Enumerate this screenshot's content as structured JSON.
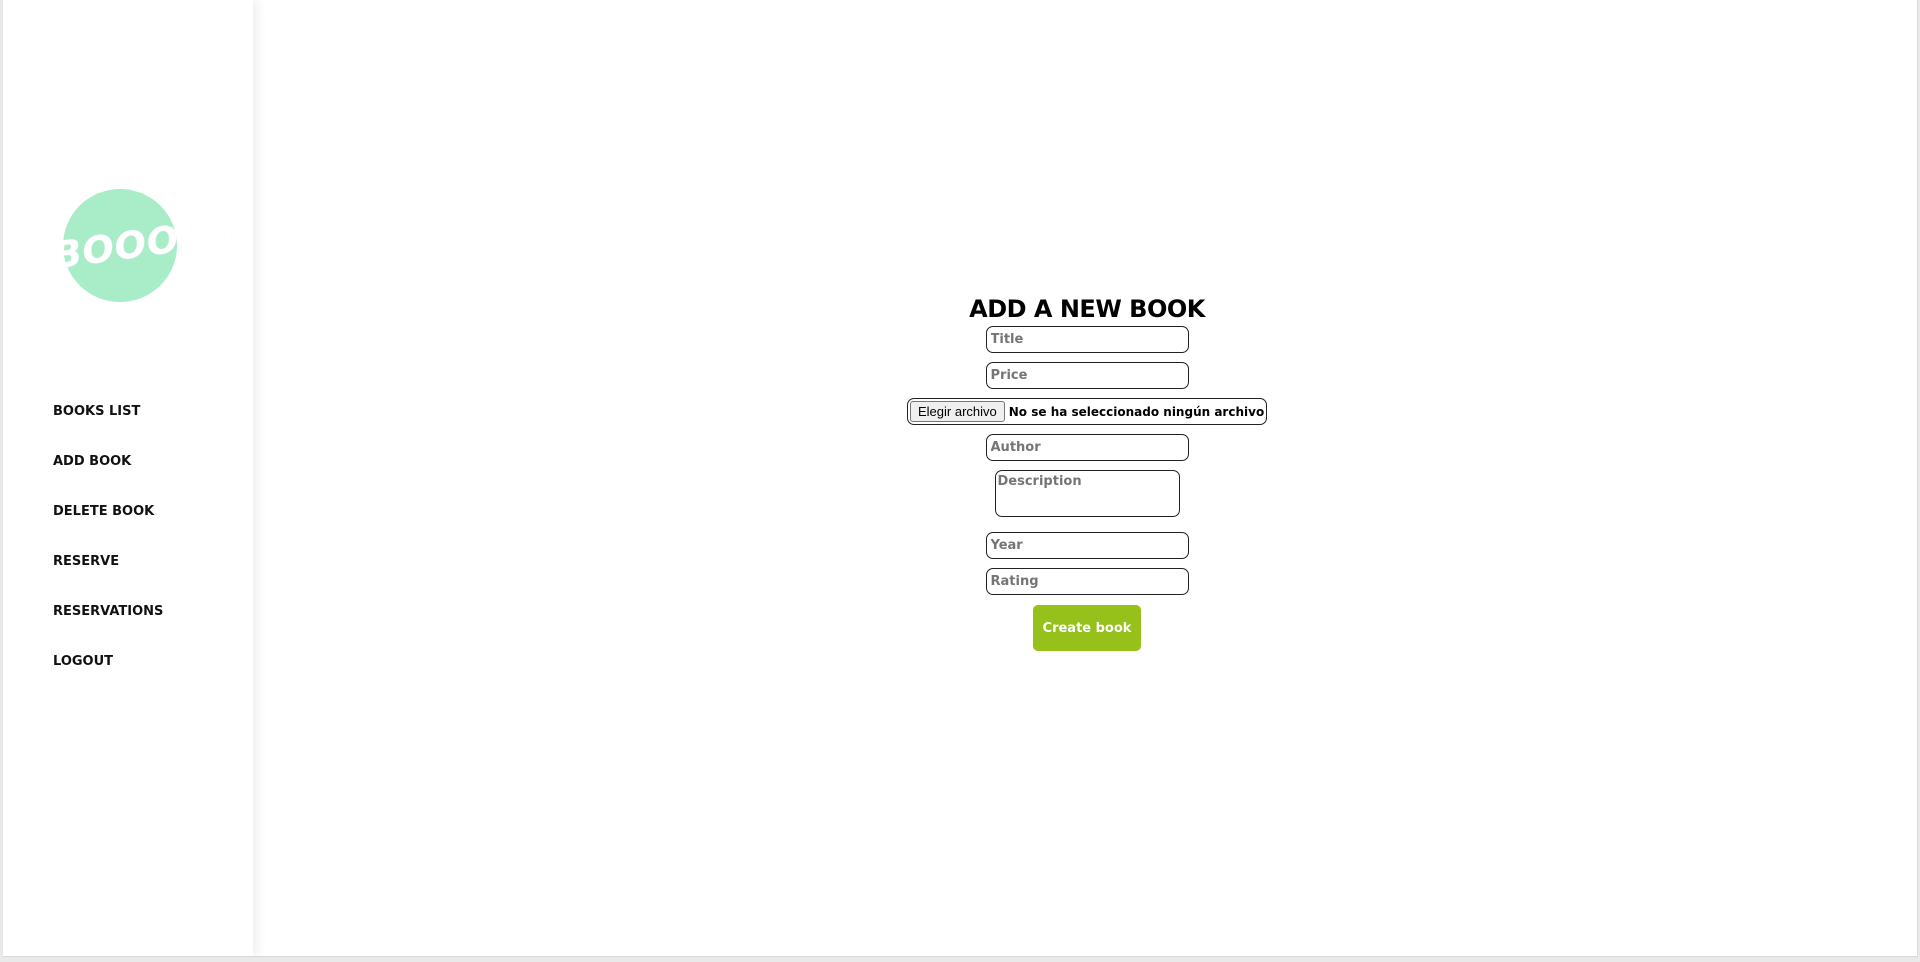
{
  "sidebar": {
    "logo_text": "BOOOKS",
    "items": [
      {
        "label": "BOOKS LIST"
      },
      {
        "label": "ADD BOOK"
      },
      {
        "label": "DELETE BOOK"
      },
      {
        "label": "RESERVE"
      },
      {
        "label": "RESERVATIONS"
      },
      {
        "label": "LOGOUT"
      }
    ]
  },
  "form": {
    "title": "ADD A NEW BOOK",
    "title_placeholder": "Title",
    "price_placeholder": "Price",
    "file_button_label": "Elegir archivo",
    "file_status": "No se ha seleccionado ningún archivo",
    "author_placeholder": "Author",
    "description_placeholder": "Description",
    "year_placeholder": "Year",
    "rating_placeholder": "Rating",
    "submit_label": "Create book"
  },
  "colors": {
    "logo_circle": "#a9ecc8",
    "submit_button": "#95c11a"
  }
}
